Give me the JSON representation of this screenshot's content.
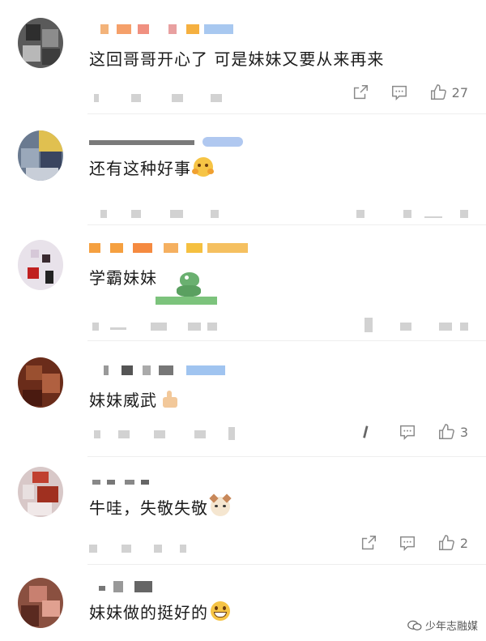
{
  "comments": [
    {
      "text": "这回哥哥开心了  可是妹妹又要从来再来",
      "likes": "27",
      "emoji": ""
    },
    {
      "text": "还有这种好事",
      "likes": "",
      "emoji": "hug-emoji-icon"
    },
    {
      "text": "学霸妹妹",
      "likes": "",
      "emoji": "dinosaur-sticker-icon"
    },
    {
      "text": "妹妹威武",
      "likes": "3",
      "emoji": "thumbs-up-emoji-icon"
    },
    {
      "text": "牛哇，失敬失敬",
      "likes": "2",
      "emoji": "cat-emoji-icon"
    },
    {
      "text": "妹妹做的挺好的",
      "likes": "",
      "emoji": "grin-emoji-icon"
    }
  ],
  "watermark": {
    "text": "少年志融媒"
  },
  "colors": {
    "accent": "#f5a623",
    "brand_blue": "#7fb2f0",
    "icon_gray": "#8a8a8a"
  }
}
